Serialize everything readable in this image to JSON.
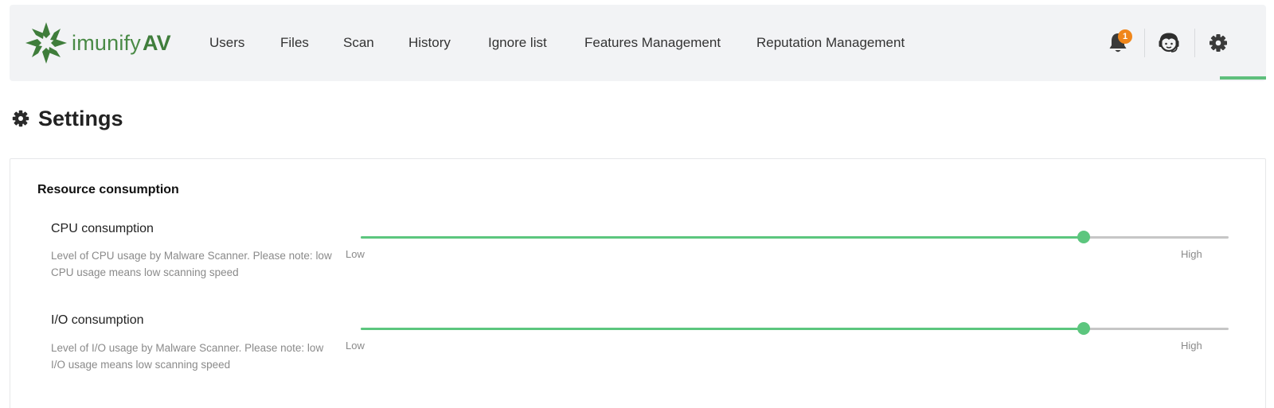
{
  "brand": {
    "name_light": "imunify",
    "name_bold": "AV",
    "logo_icon": "imunify-star-logo",
    "color": "#4a8a46"
  },
  "nav": {
    "items": [
      {
        "label": "Users"
      },
      {
        "label": "Files"
      },
      {
        "label": "Scan"
      },
      {
        "label": "History"
      },
      {
        "label": "Ignore list"
      },
      {
        "label": "Features Management"
      },
      {
        "label": "Reputation Management"
      }
    ],
    "notifications": {
      "icon": "bell-icon",
      "count": "1"
    },
    "support_icon": "support-agent-icon",
    "settings_icon": "gear-icon",
    "active": "settings"
  },
  "page": {
    "title": "Settings",
    "title_icon": "gear-icon"
  },
  "resource_consumption": {
    "title": "Resource consumption",
    "accent_color": "#5cc67e",
    "rows": [
      {
        "title": "CPU consumption",
        "description": "Level of CPU usage by Malware Scanner. Please note: low CPU usage means low scanning speed",
        "min_label": "Low",
        "max_label": "High",
        "level": 0.833
      },
      {
        "title": "I/O consumption",
        "description": "Level of I/O usage by Malware Scanner. Please note: low I/O usage means low scanning speed",
        "min_label": "Low",
        "max_label": "High",
        "level": 0.833
      }
    ]
  }
}
